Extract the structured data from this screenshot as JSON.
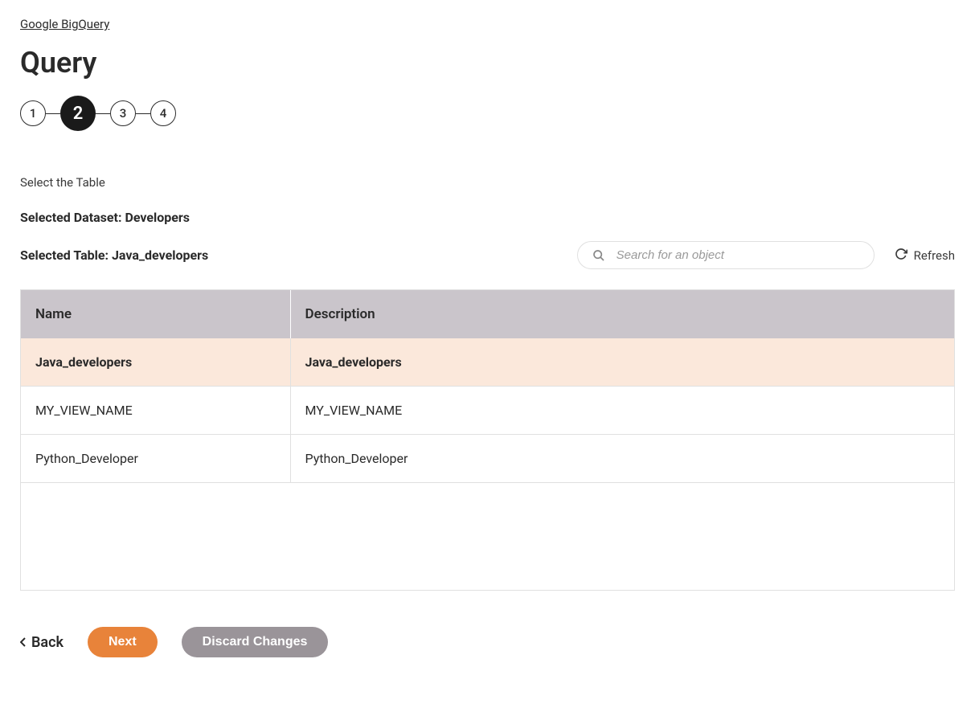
{
  "breadcrumb": {
    "label": "Google BigQuery"
  },
  "page_title": "Query",
  "stepper": {
    "steps": [
      "1",
      "2",
      "3",
      "4"
    ],
    "active_index": 1
  },
  "section_label": "Select the Table",
  "selected_dataset_line": "Selected Dataset: Developers",
  "selected_table_line": "Selected Table: Java_developers",
  "search": {
    "placeholder": "Search for an object"
  },
  "refresh_label": "Refresh",
  "table": {
    "headers": {
      "name": "Name",
      "description": "Description"
    },
    "rows": [
      {
        "name": "Java_developers",
        "description": "Java_developers",
        "selected": true
      },
      {
        "name": "MY_VIEW_NAME",
        "description": "MY_VIEW_NAME",
        "selected": false
      },
      {
        "name": "Python_Developer",
        "description": "Python_Developer",
        "selected": false
      }
    ]
  },
  "actions": {
    "back": "Back",
    "next": "Next",
    "discard": "Discard Changes"
  }
}
